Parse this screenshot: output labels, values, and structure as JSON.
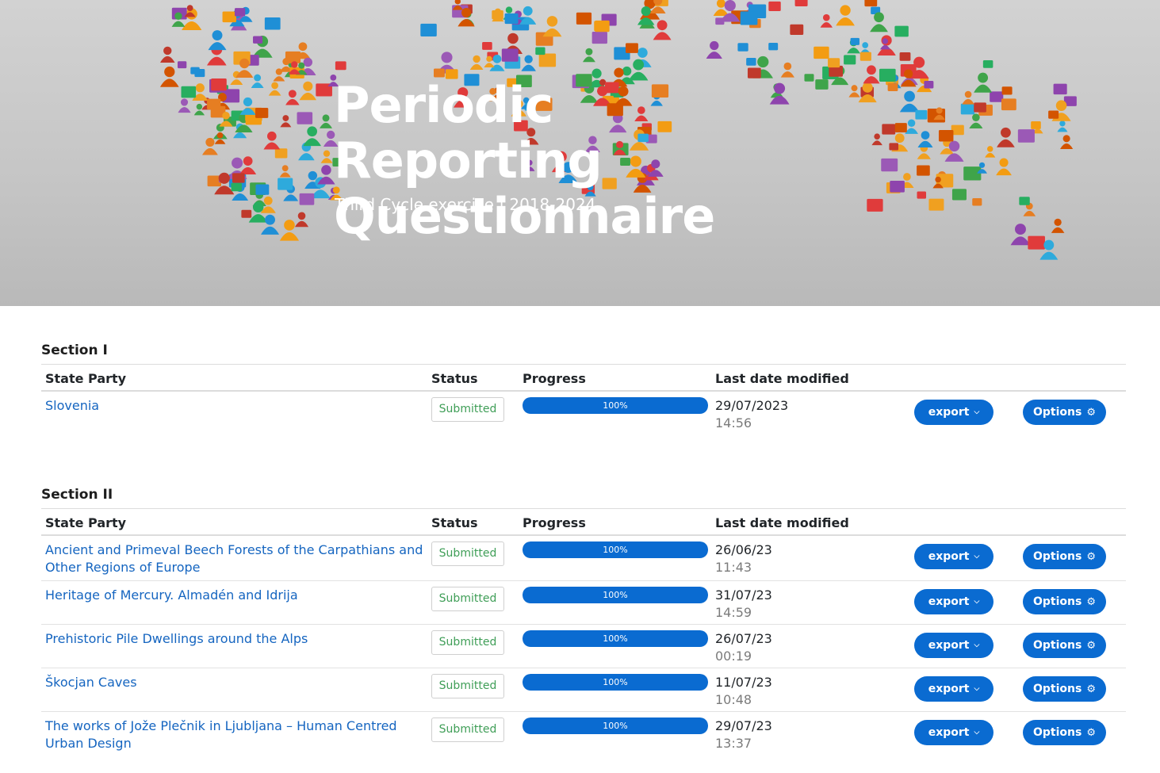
{
  "hero": {
    "title": "Periodic Reporting Questionnaire",
    "subtitle": "Third Cycle exercise | 2018-2024"
  },
  "table_headers": {
    "state_party": "State Party",
    "status": "Status",
    "progress": "Progress",
    "last_modified": "Last date modified"
  },
  "sections": [
    {
      "title": "Section I",
      "rows": [
        {
          "name": "Slovenia",
          "status": "Submitted",
          "progress": 100,
          "progress_label": "100%",
          "date": "29/07/2023",
          "time": "14:56",
          "export_label": "export",
          "options_label": "Options"
        }
      ]
    },
    {
      "title": "Section II",
      "rows": [
        {
          "name": "Ancient and Primeval Beech Forests of the Carpathians and Other Regions of Europe",
          "status": "Submitted",
          "progress": 100,
          "progress_label": "100%",
          "date": "26/06/23",
          "time": "11:43",
          "export_label": "export",
          "options_label": "Options"
        },
        {
          "name": "Heritage of Mercury. Almadén and Idrija",
          "status": "Submitted",
          "progress": 100,
          "progress_label": "100%",
          "date": "31/07/23",
          "time": "14:59",
          "export_label": "export",
          "options_label": "Options"
        },
        {
          "name": "Prehistoric Pile Dwellings around the Alps",
          "status": "Submitted",
          "progress": 100,
          "progress_label": "100%",
          "date": "26/07/23",
          "time": "00:19",
          "export_label": "export",
          "options_label": "Options"
        },
        {
          "name": "Škocjan Caves",
          "status": "Submitted",
          "progress": 100,
          "progress_label": "100%",
          "date": "11/07/23",
          "time": "10:48",
          "export_label": "export",
          "options_label": "Options"
        },
        {
          "name": "The works of Jože Plečnik in Ljubljana – Human Centred Urban Design",
          "status": "Submitted",
          "progress": 100,
          "progress_label": "100%",
          "date": "29/07/23",
          "time": "13:37",
          "export_label": "export",
          "options_label": "Options"
        }
      ]
    }
  ],
  "icons": {
    "export_caret": "chevron-down-icon",
    "options_icon": "gear-icon"
  },
  "colors": {
    "accent": "#0a6bd1",
    "link": "#1565c0",
    "status_text": "#3f9e57"
  }
}
